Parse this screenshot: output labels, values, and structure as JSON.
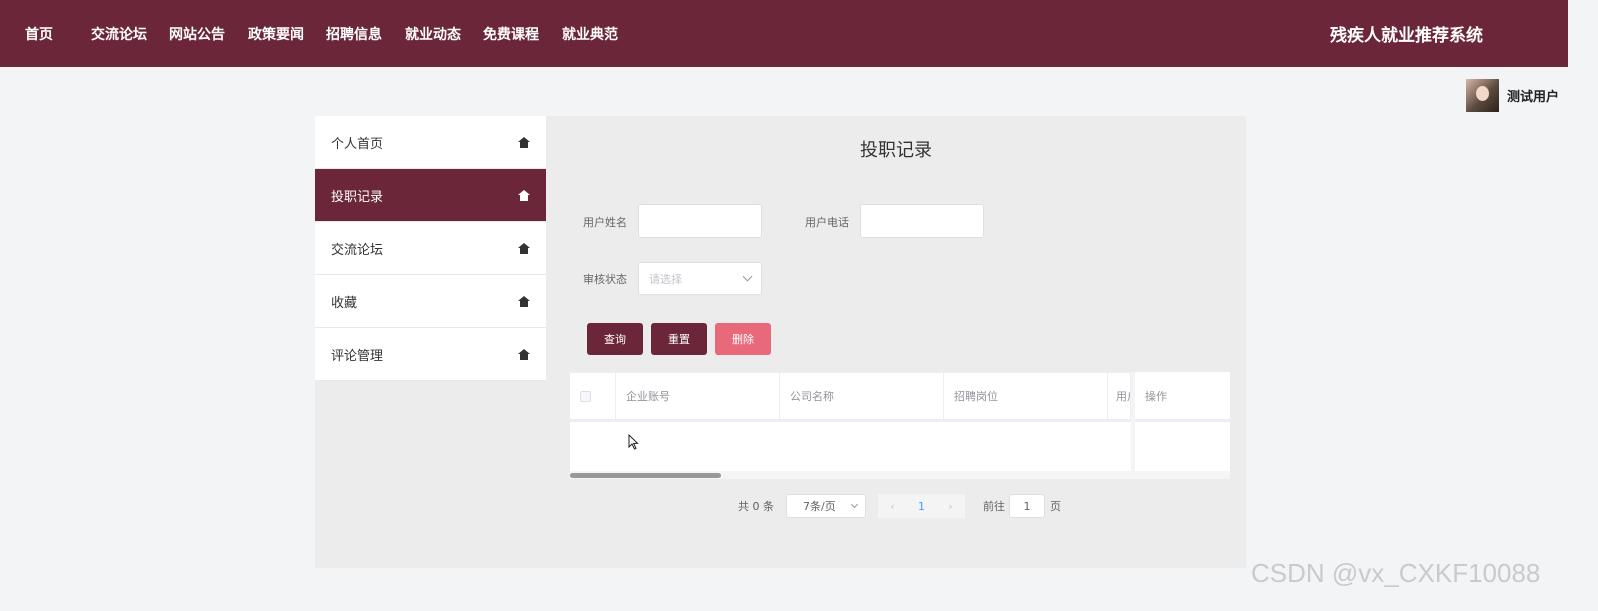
{
  "nav": {
    "items": [
      {
        "label": "首页"
      },
      {
        "label": "交流论坛"
      },
      {
        "label": "网站公告"
      },
      {
        "label": "政策要闻"
      },
      {
        "label": "招聘信息"
      },
      {
        "label": "就业动态"
      },
      {
        "label": "免费课程"
      },
      {
        "label": "就业典范"
      }
    ],
    "site_title": "残疾人就业推荐系统"
  },
  "user": {
    "name": "测试用户",
    "avatar_icon": "avatar-photo"
  },
  "sidebar": {
    "items": [
      {
        "label": "个人首页",
        "icon": "home-icon",
        "active": false
      },
      {
        "label": "投职记录",
        "icon": "home-icon",
        "active": true
      },
      {
        "label": "交流论坛",
        "icon": "home-icon",
        "active": false
      },
      {
        "label": "收藏",
        "icon": "home-icon",
        "active": false
      },
      {
        "label": "评论管理",
        "icon": "home-icon",
        "active": false
      }
    ]
  },
  "main": {
    "title": "投职记录",
    "search": {
      "user_name_label": "用户姓名",
      "user_name_value": "",
      "user_phone_label": "用户电话",
      "user_phone_value": "",
      "status_label": "审核状态",
      "status_placeholder": "请选择"
    },
    "buttons": {
      "query": "查询",
      "reset": "重置",
      "delete": "删除"
    },
    "table": {
      "columns": [
        "企业账号",
        "公司名称",
        "招聘岗位",
        "用户",
        "操作"
      ],
      "rows": []
    },
    "pagination": {
      "total_text": "共 0 条",
      "page_size": "7条/页",
      "prev": "‹",
      "current_page": "1",
      "next": "›",
      "jump_label": "前往",
      "jump_value": "1",
      "page_unit": "页"
    }
  },
  "colors": {
    "brand": "#6b2739",
    "danger": "#e8697a",
    "link": "#409eff"
  },
  "watermark": "CSDN @vx_CXKF10088"
}
